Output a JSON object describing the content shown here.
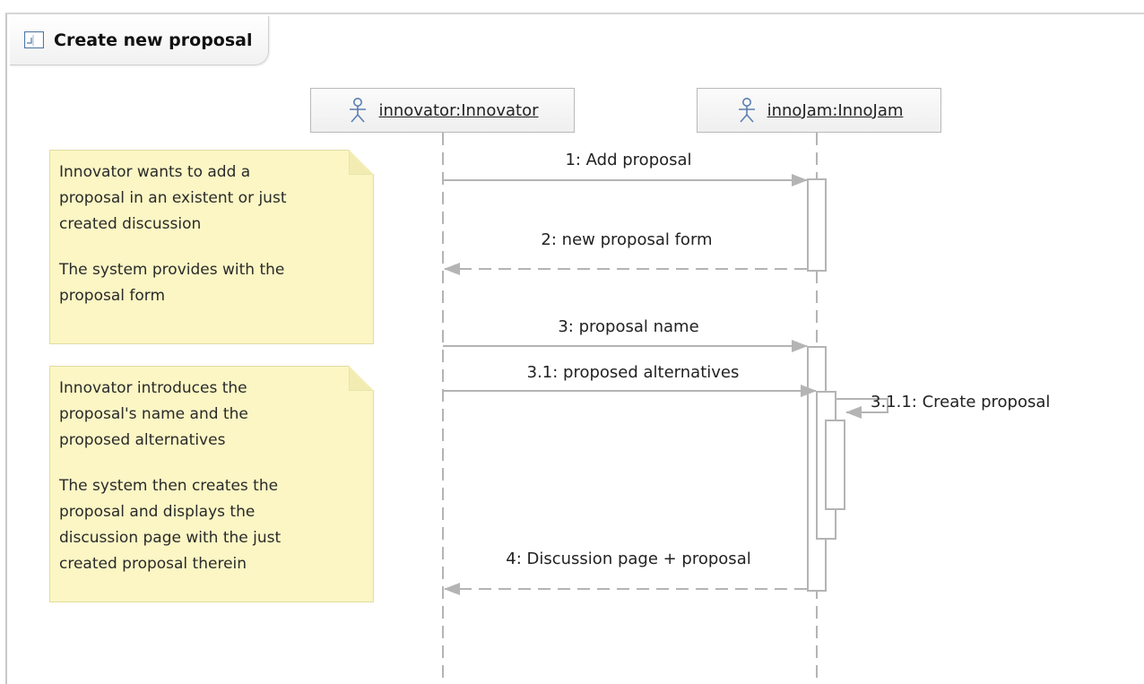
{
  "frame": {
    "title": "Create new proposal"
  },
  "lifelines": [
    {
      "name": "innovator:Innovator"
    },
    {
      "name": "innoJam:InnoJam"
    }
  ],
  "notes": [
    {
      "paragraphs": [
        "Innovator wants to add a\nproposal in an existent or just\ncreated discussion",
        "The system provides with the\nproposal form"
      ]
    },
    {
      "paragraphs": [
        "Innovator introduces the\nproposal's name and the\nproposed alternatives",
        "The system then creates the\nproposal and displays the\ndiscussion page with the just\ncreated proposal therein"
      ]
    }
  ],
  "messages": [
    {
      "label": "1: Add proposal",
      "kind": "sync"
    },
    {
      "label": "2: new proposal form",
      "kind": "return"
    },
    {
      "label": "3: proposal name",
      "kind": "sync"
    },
    {
      "label": "3.1: proposed alternatives",
      "kind": "sync"
    },
    {
      "label": "3.1.1: Create proposal",
      "kind": "self"
    },
    {
      "label": "4: Discussion page + proposal",
      "kind": "return"
    }
  ],
  "colors": {
    "line": "#b4b4b4",
    "note_fill": "#fbf6c4",
    "actor": "#5b7fb0"
  }
}
